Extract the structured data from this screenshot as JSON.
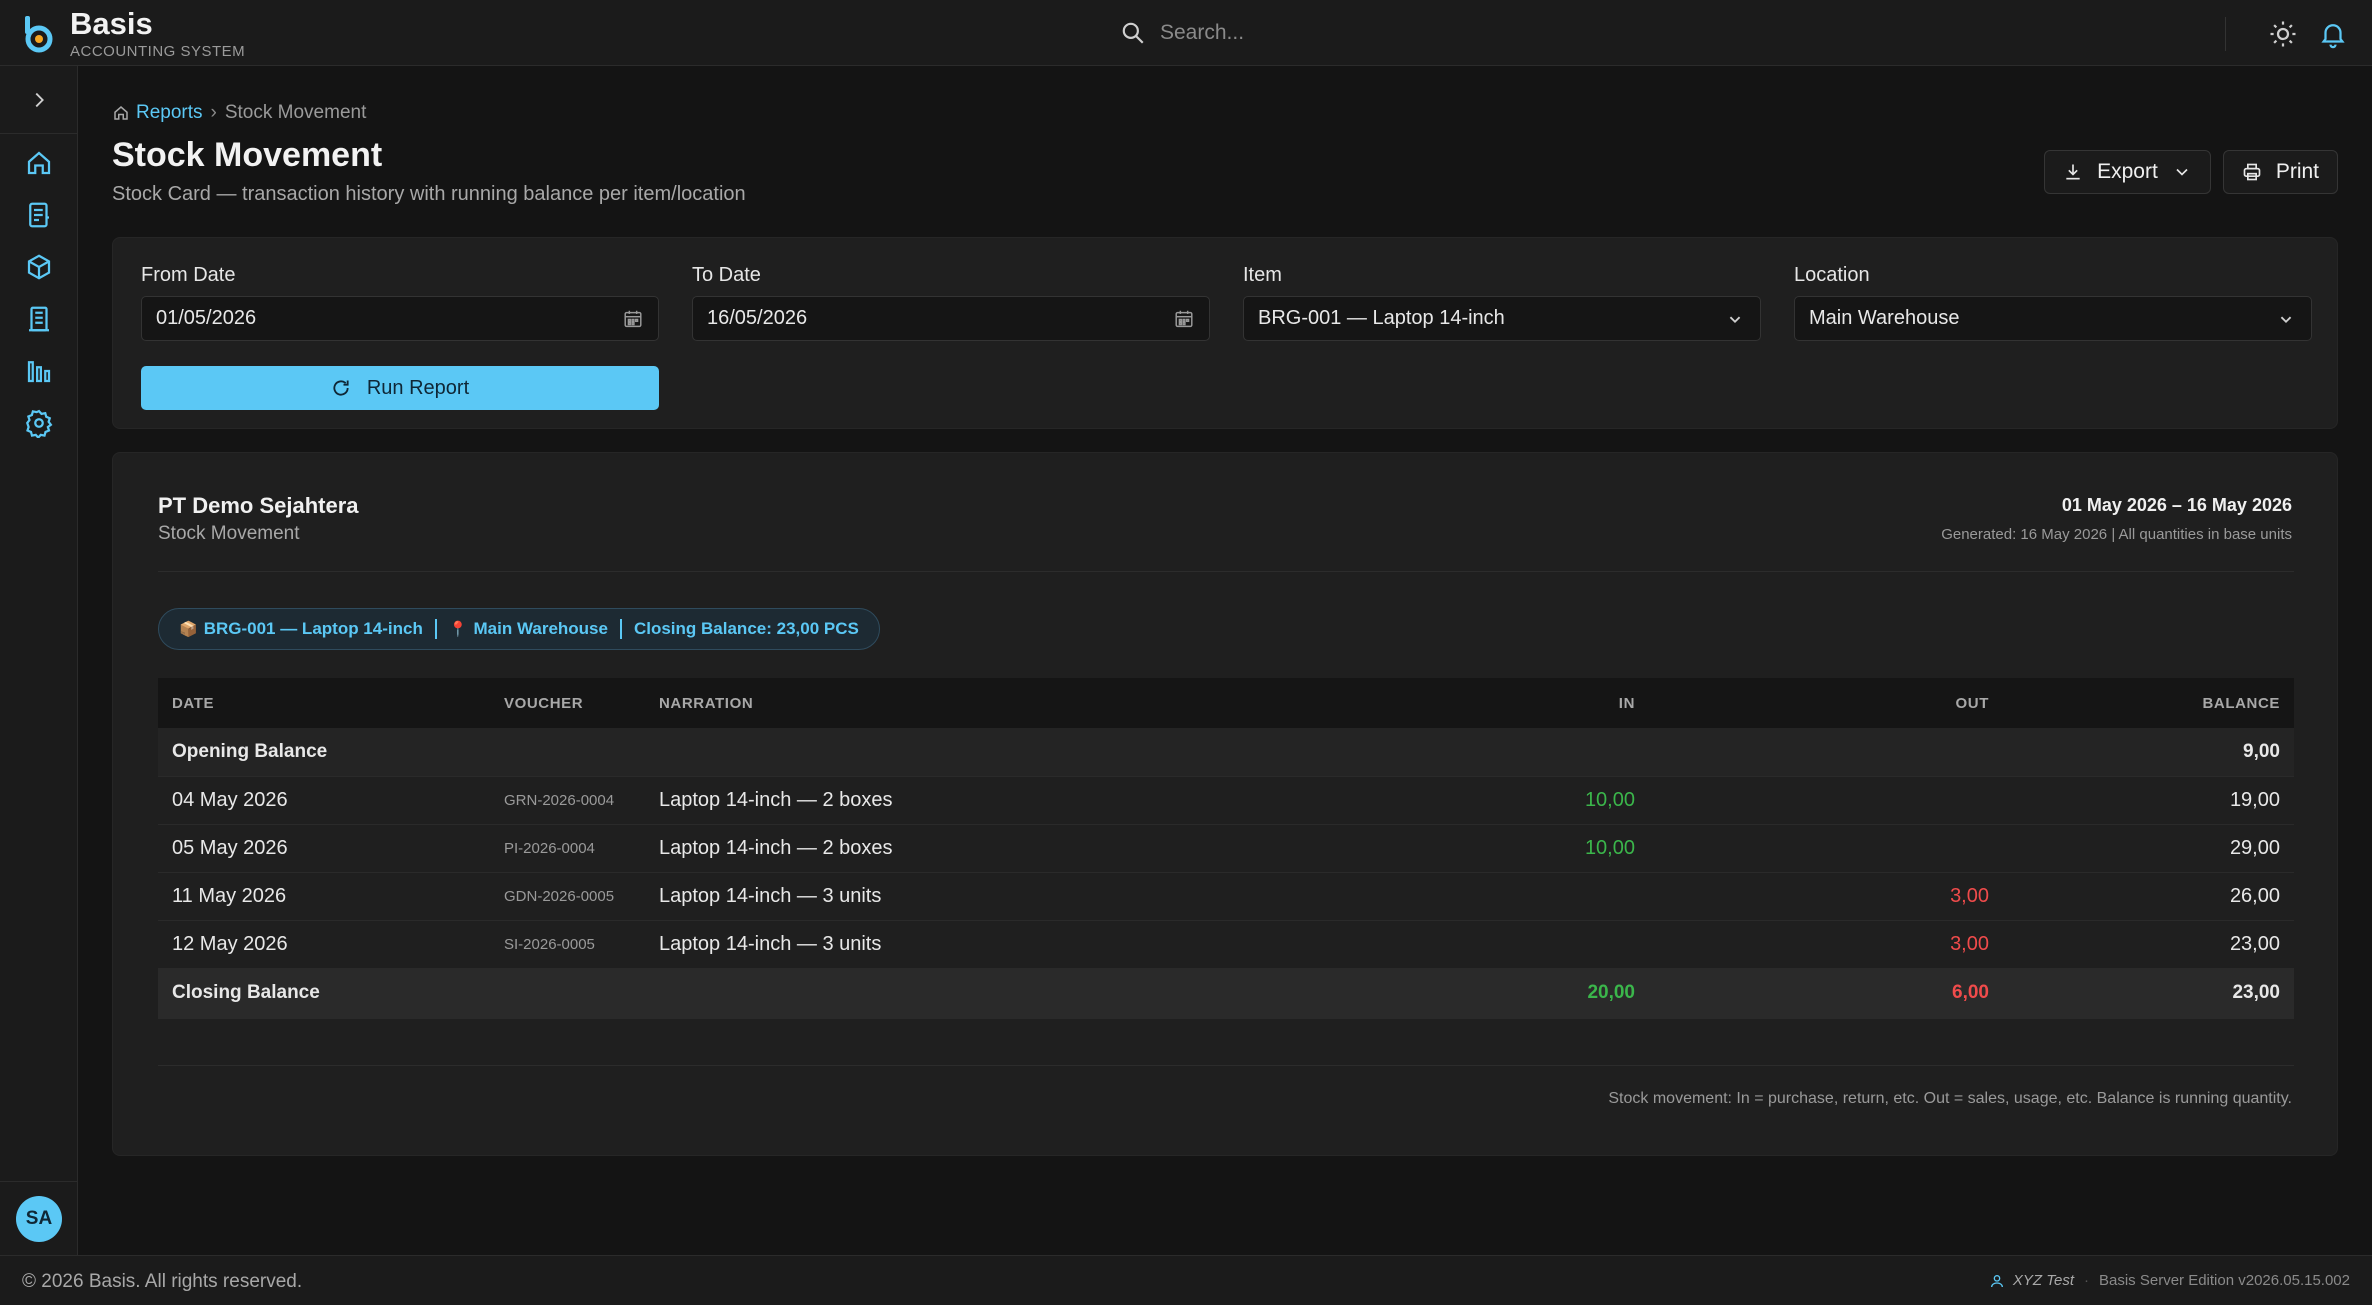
{
  "header": {
    "brand_name": "Basis",
    "brand_sub": "ACCOUNTING SYSTEM",
    "search_placeholder": "Search..."
  },
  "sidebar": {
    "items": [
      "home-icon",
      "journal-icon",
      "inventory-icon",
      "document-icon",
      "reports-icon",
      "settings-icon"
    ],
    "avatar_initials": "SA"
  },
  "breadcrumb": {
    "root": "Reports",
    "current": "Stock Movement"
  },
  "page": {
    "title": "Stock Movement",
    "subtitle": "Stock Card — transaction history with running balance per item/location",
    "export_label": "Export",
    "print_label": "Print"
  },
  "filters": {
    "from_label": "From Date",
    "from_value": "01/05/2026",
    "to_label": "To Date",
    "to_value": "16/05/2026",
    "item_label": "Item",
    "item_value": "BRG-001 — Laptop 14-inch",
    "location_label": "Location",
    "location_value": "Main Warehouse",
    "run_label": "Run Report"
  },
  "report": {
    "company": "PT Demo Sejahtera",
    "name": "Stock Movement",
    "period": "01 May 2026 – 16 May 2026",
    "generated": "Generated: 16 May 2026 | All quantities in base units",
    "chip": {
      "item": "BRG-001 — Laptop 14-inch",
      "location": "Main Warehouse",
      "closing": "Closing Balance: 23,00 PCS"
    },
    "columns": {
      "date": "DATE",
      "voucher": "VOUCHER",
      "narration": "NARRATION",
      "in": "IN",
      "out": "OUT",
      "balance": "BALANCE"
    },
    "opening": {
      "label": "Opening Balance",
      "balance": "9,00"
    },
    "rows": [
      {
        "date": "04 May 2026",
        "voucher": "GRN-2026-0004",
        "narration": "Laptop 14-inch — 2 boxes",
        "in": "10,00",
        "out": "",
        "balance": "19,00"
      },
      {
        "date": "05 May 2026",
        "voucher": "PI-2026-0004",
        "narration": "Laptop 14-inch — 2 boxes",
        "in": "10,00",
        "out": "",
        "balance": "29,00"
      },
      {
        "date": "11 May 2026",
        "voucher": "GDN-2026-0005",
        "narration": "Laptop 14-inch — 3 units",
        "in": "",
        "out": "3,00",
        "balance": "26,00"
      },
      {
        "date": "12 May 2026",
        "voucher": "SI-2026-0005",
        "narration": "Laptop 14-inch — 3 units",
        "in": "",
        "out": "3,00",
        "balance": "23,00"
      }
    ],
    "closing": {
      "label": "Closing Balance",
      "in": "20,00",
      "out": "6,00",
      "balance": "23,00"
    },
    "note": "Stock movement: In = purchase, return, etc. Out = sales, usage, etc. Balance is running quantity."
  },
  "footer": {
    "copyright": "© 2026 Basis. All rights reserved.",
    "user": "XYZ Test",
    "edition": "Basis Server Edition v2026.05.15.002"
  },
  "colors": {
    "accent": "#5bc8f5",
    "in": "#3bb64b",
    "out": "#f04b4b",
    "background": "#141414"
  }
}
